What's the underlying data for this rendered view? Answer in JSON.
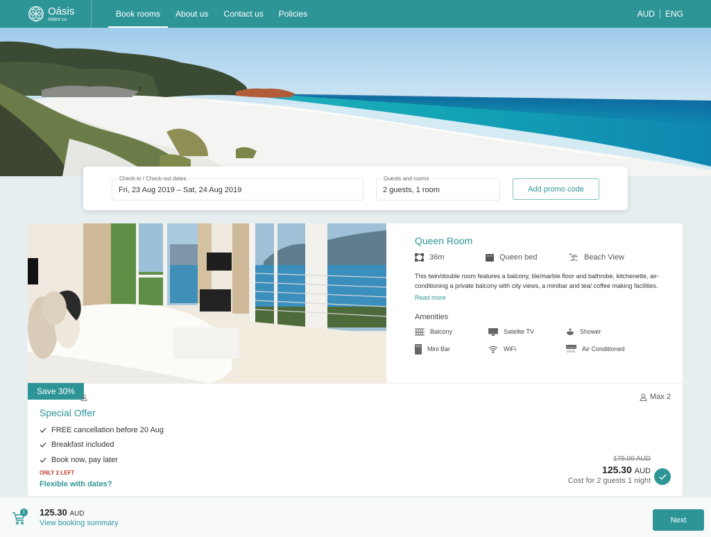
{
  "brand": {
    "name": "Oásis",
    "subtitle": "Atlânt co"
  },
  "nav": {
    "items": [
      {
        "label": "Book rooms",
        "active": true
      },
      {
        "label": "About us",
        "active": false
      },
      {
        "label": "Contact us",
        "active": false
      },
      {
        "label": "Policies",
        "active": false
      }
    ],
    "currency": "AUD",
    "language": "ENG"
  },
  "search": {
    "dates_label": "Check-in / Check-out dates",
    "dates_value": "Fri, 23 Aug 2019 – Sat, 24 Aug 2019",
    "guests_label": "Guests and rooms",
    "guests_value": "2 guests, 1 room",
    "promo_button": "Add promo code"
  },
  "room": {
    "title": "Queen Room",
    "specs": {
      "size": "36m",
      "bed": "Queen bed",
      "view": "Beach View"
    },
    "description": "This twin/double room features a balcony, tile/marble floor and bathrobe, kitchenette, air-conditioning a private balcony with city views, a minibar and tea/ coffee making facilities.",
    "read_more": "Read more",
    "amenities_title": "Amenities",
    "amenities": [
      {
        "label": "Balcony",
        "icon": "balcony-icon"
      },
      {
        "label": "Satelite TV",
        "icon": "tv-icon"
      },
      {
        "label": "Shower",
        "icon": "shower-icon"
      },
      {
        "label": "Mini Bar",
        "icon": "minibar-icon"
      },
      {
        "label": "WiFi",
        "icon": "wifi-icon"
      },
      {
        "label": "Air Conditioned",
        "icon": "air-conditioner-icon"
      }
    ]
  },
  "offer": {
    "badge": "Save 30%",
    "title": "Special Offer",
    "perks": [
      "FREE cancellation before 20 Aug",
      "Breakfast included",
      "Book now, pay later"
    ],
    "availability": "ONLY 2 LEFT",
    "flexible_link": "Flexible with dates?",
    "max_guests": "Max 2",
    "old_price": "179.00 AUD",
    "price": "125.30",
    "currency": "AUD",
    "cost_note": "Cost for 2 guests 1 night",
    "selected": true
  },
  "footer": {
    "cart_count": "1",
    "total": "125.30",
    "currency": "AUD",
    "summary_link": "View booking summary",
    "next_button": "Next"
  },
  "colors": {
    "brand": "#2e9597",
    "background": "#e6eef0",
    "warning": "#c0392b"
  }
}
